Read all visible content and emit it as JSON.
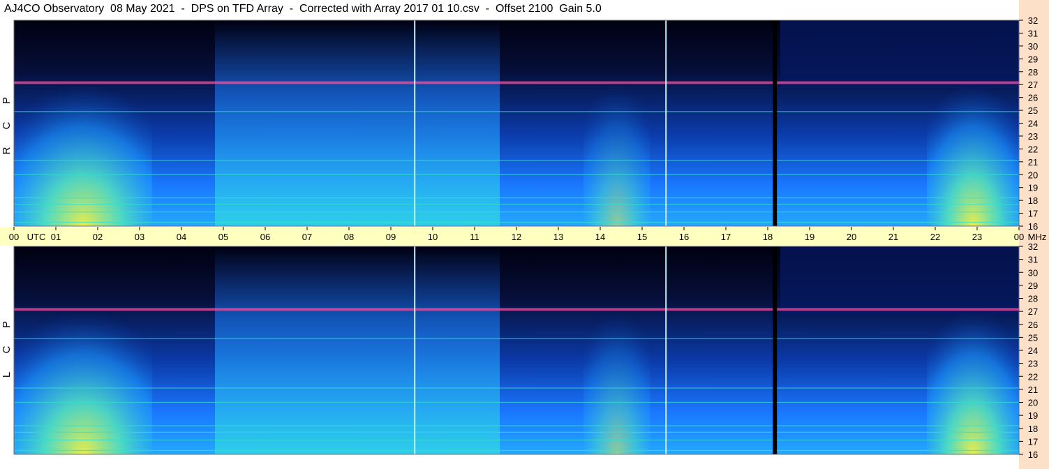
{
  "title": "AJ4CO Observatory  08 May 2021  -  DPS on TFD Array  -  Corrected with Array 2017 01 10.csv  -  Offset 2100  Gain 5.0",
  "colors": {
    "background": "#ffffff",
    "time_axis_band": "#ffffc0",
    "freq_axis_band": "#fde0c8",
    "spectrogram_low": "#000016",
    "spectrogram_mid": "#1a6cff",
    "spectrogram_high": "#35e0d0",
    "spectrogram_peak": "#ff4fa0"
  },
  "chart_data": [
    {
      "type": "heatmap",
      "panel": "top",
      "polarization_letters": [
        "R",
        "C",
        "P"
      ],
      "x_axis": {
        "tick_labels": [
          "00",
          "01",
          "02",
          "03",
          "04",
          "05",
          "06",
          "07",
          "08",
          "09",
          "10",
          "11",
          "12",
          "13",
          "14",
          "15",
          "16",
          "17",
          "18",
          "19",
          "20",
          "21",
          "22",
          "23",
          "00"
        ],
        "utc_label": "UTC",
        "range_hours": [
          0,
          24
        ]
      },
      "y_axis": {
        "tick_labels": [
          "32",
          "31",
          "30",
          "29",
          "28",
          "27",
          "26",
          "25",
          "24",
          "23",
          "22",
          "21",
          "20",
          "19",
          "18",
          "17",
          "16"
        ],
        "unit_label": "MHz",
        "range_mhz": [
          16,
          32
        ]
      },
      "vertical_lines_utc_hours": [
        9.57,
        15.57,
        18.17
      ],
      "interference_bands_mhz": [
        16.3,
        17.1,
        17.7,
        18.2,
        20.0,
        21.1,
        24.9,
        27.1,
        27.2
      ],
      "brightness_note": "intensity rises toward lower frequencies; high-intensity periods near 00-05 UTC and 23-24 UTC"
    },
    {
      "type": "heatmap",
      "panel": "bottom",
      "polarization_letters": [
        "L",
        "C",
        "P"
      ],
      "x_axis": {
        "tick_labels": [
          "00",
          "01",
          "02",
          "03",
          "04",
          "05",
          "06",
          "07",
          "08",
          "09",
          "10",
          "11",
          "12",
          "13",
          "14",
          "15",
          "16",
          "17",
          "18",
          "19",
          "20",
          "21",
          "22",
          "23",
          "00"
        ],
        "utc_label": "UTC",
        "range_hours": [
          0,
          24
        ]
      },
      "y_axis": {
        "tick_labels": [
          "32",
          "31",
          "30",
          "29",
          "28",
          "27",
          "26",
          "25",
          "24",
          "23",
          "22",
          "21",
          "20",
          "19",
          "18",
          "17",
          "16"
        ],
        "unit_label": "MHz",
        "range_mhz": [
          16,
          32
        ]
      },
      "vertical_lines_utc_hours": [
        9.57,
        15.57,
        18.17
      ],
      "interference_bands_mhz": [
        16.3,
        17.1,
        17.7,
        18.2,
        20.0,
        21.1,
        24.9,
        27.1,
        27.2
      ],
      "brightness_note": "intensity rises toward lower frequencies; high-intensity periods near 00-05 UTC and 23-24 UTC"
    }
  ]
}
